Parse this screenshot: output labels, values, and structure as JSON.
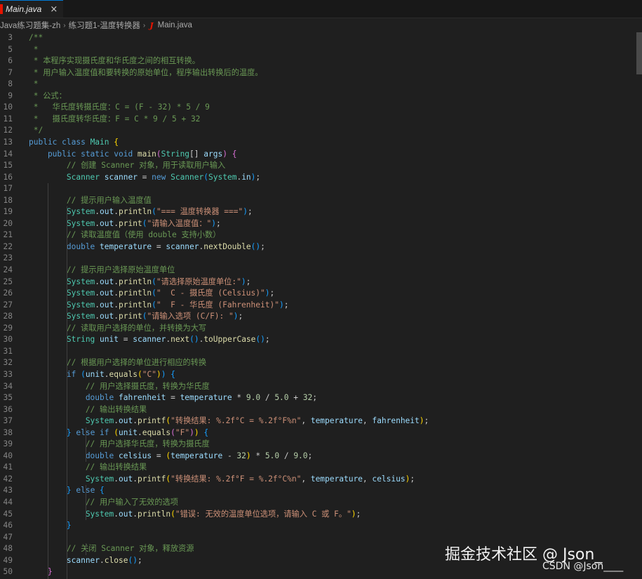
{
  "tab": {
    "label": "Main.java",
    "close": "×"
  },
  "breadcrumb": [
    "Java练习题集-zh",
    "练习题1-温度转换器",
    "Main.java"
  ],
  "breadcrumb_sep": "›",
  "java_icon": "J",
  "watermark": {
    "primary": "掘金技术社区 @ Json_",
    "secondary": "CSDN @Json____"
  },
  "lines": [
    {
      "n": "3",
      "t": [
        [
          "/**",
          "c-cm"
        ]
      ]
    },
    {
      "n": "5",
      "t": [
        [
          " *",
          "c-cm"
        ]
      ]
    },
    {
      "n": "6",
      "t": [
        [
          " * 本程序实现摄氏度和华氏度之间的相互转换。",
          "c-cm"
        ]
      ]
    },
    {
      "n": "7",
      "t": [
        [
          " * 用户输入温度值和要转换的原始单位，程序输出转换后的温度。",
          "c-cm"
        ]
      ]
    },
    {
      "n": "8",
      "t": [
        [
          " *",
          "c-cm"
        ]
      ]
    },
    {
      "n": "9",
      "t": [
        [
          " * 公式：",
          "c-cm"
        ]
      ]
    },
    {
      "n": "10",
      "t": [
        [
          " *   华氏度转摄氏度：C = (F - 32) * 5 / 9",
          "c-cm"
        ]
      ]
    },
    {
      "n": "11",
      "t": [
        [
          " *   摄氏度转华氏度：F = C * 9 / 5 + 32",
          "c-cm"
        ]
      ]
    },
    {
      "n": "12",
      "t": [
        [
          " */",
          "c-cm"
        ]
      ]
    },
    {
      "n": "13",
      "t": [
        [
          "public class ",
          "c-kw"
        ],
        [
          "Main ",
          "c-ty"
        ],
        [
          "{",
          "c-br1"
        ]
      ]
    },
    {
      "n": "14",
      "t": [
        [
          "    public static void ",
          "c-kw"
        ],
        [
          "main",
          "c-fn"
        ],
        [
          "(",
          "c-br2"
        ],
        [
          "String",
          "c-ty"
        ],
        [
          "[] ",
          "c-pl"
        ],
        [
          "args",
          "c-vr"
        ],
        [
          ") ",
          "c-br2"
        ],
        [
          "{",
          "c-br2"
        ]
      ]
    },
    {
      "n": "15",
      "t": [
        [
          "        // 创建 Scanner 对象，用于读取用户输入",
          "c-cm"
        ]
      ]
    },
    {
      "n": "16",
      "t": [
        [
          "        Scanner ",
          "c-ty"
        ],
        [
          "scanner",
          "c-vr"
        ],
        [
          " = ",
          "c-pl"
        ],
        [
          "new ",
          "c-kw"
        ],
        [
          "Scanner",
          "c-ty"
        ],
        [
          "(",
          "c-br3"
        ],
        [
          "System",
          "c-ty"
        ],
        [
          ".",
          "c-pl"
        ],
        [
          "in",
          "c-vr"
        ],
        [
          ")",
          "c-br3"
        ],
        [
          ";",
          "c-pl"
        ]
      ]
    },
    {
      "n": "17",
      "t": [
        [
          "",
          "c-pl"
        ]
      ]
    },
    {
      "n": "18",
      "t": [
        [
          "        // 提示用户输入温度值",
          "c-cm"
        ]
      ]
    },
    {
      "n": "19",
      "t": [
        [
          "        System",
          "c-ty"
        ],
        [
          ".",
          "c-pl"
        ],
        [
          "out",
          "c-vr"
        ],
        [
          ".",
          "c-pl"
        ],
        [
          "println",
          "c-fn"
        ],
        [
          "(",
          "c-br3"
        ],
        [
          "\"=== 温度转换器 ===\"",
          "c-st"
        ],
        [
          ")",
          "c-br3"
        ],
        [
          ";",
          "c-pl"
        ]
      ]
    },
    {
      "n": "20",
      "t": [
        [
          "        System",
          "c-ty"
        ],
        [
          ".",
          "c-pl"
        ],
        [
          "out",
          "c-vr"
        ],
        [
          ".",
          "c-pl"
        ],
        [
          "print",
          "c-fn"
        ],
        [
          "(",
          "c-br3"
        ],
        [
          "\"请输入温度值：\"",
          "c-st"
        ],
        [
          ")",
          "c-br3"
        ],
        [
          ";",
          "c-pl"
        ]
      ]
    },
    {
      "n": "21",
      "t": [
        [
          "        // 读取温度值（使用 double 支持小数）",
          "c-cm"
        ]
      ]
    },
    {
      "n": "22",
      "t": [
        [
          "        double ",
          "c-kw"
        ],
        [
          "temperature",
          "c-vr"
        ],
        [
          " = ",
          "c-pl"
        ],
        [
          "scanner",
          "c-vr"
        ],
        [
          ".",
          "c-pl"
        ],
        [
          "nextDouble",
          "c-fn"
        ],
        [
          "()",
          "c-br3"
        ],
        [
          ";",
          "c-pl"
        ]
      ]
    },
    {
      "n": "23",
      "t": [
        [
          "",
          "c-pl"
        ]
      ]
    },
    {
      "n": "24",
      "t": [
        [
          "        // 提示用户选择原始温度单位",
          "c-cm"
        ]
      ]
    },
    {
      "n": "25",
      "t": [
        [
          "        System",
          "c-ty"
        ],
        [
          ".",
          "c-pl"
        ],
        [
          "out",
          "c-vr"
        ],
        [
          ".",
          "c-pl"
        ],
        [
          "println",
          "c-fn"
        ],
        [
          "(",
          "c-br3"
        ],
        [
          "\"请选择原始温度单位:\"",
          "c-st"
        ],
        [
          ")",
          "c-br3"
        ],
        [
          ";",
          "c-pl"
        ]
      ]
    },
    {
      "n": "26",
      "t": [
        [
          "        System",
          "c-ty"
        ],
        [
          ".",
          "c-pl"
        ],
        [
          "out",
          "c-vr"
        ],
        [
          ".",
          "c-pl"
        ],
        [
          "println",
          "c-fn"
        ],
        [
          "(",
          "c-br3"
        ],
        [
          "\"  C - 摄氏度 (Celsius)\"",
          "c-st"
        ],
        [
          ")",
          "c-br3"
        ],
        [
          ";",
          "c-pl"
        ]
      ]
    },
    {
      "n": "27",
      "t": [
        [
          "        System",
          "c-ty"
        ],
        [
          ".",
          "c-pl"
        ],
        [
          "out",
          "c-vr"
        ],
        [
          ".",
          "c-pl"
        ],
        [
          "println",
          "c-fn"
        ],
        [
          "(",
          "c-br3"
        ],
        [
          "\"  F - 华氏度 (Fahrenheit)\"",
          "c-st"
        ],
        [
          ")",
          "c-br3"
        ],
        [
          ";",
          "c-pl"
        ]
      ]
    },
    {
      "n": "28",
      "t": [
        [
          "        System",
          "c-ty"
        ],
        [
          ".",
          "c-pl"
        ],
        [
          "out",
          "c-vr"
        ],
        [
          ".",
          "c-pl"
        ],
        [
          "print",
          "c-fn"
        ],
        [
          "(",
          "c-br3"
        ],
        [
          "\"请输入选项 (C/F): \"",
          "c-st"
        ],
        [
          ")",
          "c-br3"
        ],
        [
          ";",
          "c-pl"
        ]
      ]
    },
    {
      "n": "29",
      "t": [
        [
          "        // 读取用户选择的单位，并转换为大写",
          "c-cm"
        ]
      ]
    },
    {
      "n": "30",
      "t": [
        [
          "        String ",
          "c-ty"
        ],
        [
          "unit",
          "c-vr"
        ],
        [
          " = ",
          "c-pl"
        ],
        [
          "scanner",
          "c-vr"
        ],
        [
          ".",
          "c-pl"
        ],
        [
          "next",
          "c-fn"
        ],
        [
          "()",
          "c-br3"
        ],
        [
          ".",
          "c-pl"
        ],
        [
          "toUpperCase",
          "c-fn"
        ],
        [
          "()",
          "c-br3"
        ],
        [
          ";",
          "c-pl"
        ]
      ]
    },
    {
      "n": "31",
      "t": [
        [
          "",
          "c-pl"
        ]
      ]
    },
    {
      "n": "32",
      "t": [
        [
          "        // 根据用户选择的单位进行相应的转换",
          "c-cm"
        ]
      ]
    },
    {
      "n": "33",
      "t": [
        [
          "        if ",
          "c-kw"
        ],
        [
          "(",
          "c-br3"
        ],
        [
          "unit",
          "c-vr"
        ],
        [
          ".",
          "c-pl"
        ],
        [
          "equals",
          "c-fn"
        ],
        [
          "(",
          "c-br1"
        ],
        [
          "\"C\"",
          "c-st"
        ],
        [
          ")",
          "c-br1"
        ],
        [
          ") ",
          "c-br3"
        ],
        [
          "{",
          "c-br3"
        ]
      ]
    },
    {
      "n": "34",
      "t": [
        [
          "            // 用户选择摄氏度，转换为华氏度",
          "c-cm"
        ]
      ]
    },
    {
      "n": "35",
      "t": [
        [
          "            double ",
          "c-kw"
        ],
        [
          "fahrenheit",
          "c-vr"
        ],
        [
          " = ",
          "c-pl"
        ],
        [
          "temperature",
          "c-vr"
        ],
        [
          " * ",
          "c-pl"
        ],
        [
          "9.0",
          "c-nm"
        ],
        [
          " / ",
          "c-pl"
        ],
        [
          "5.0",
          "c-nm"
        ],
        [
          " + ",
          "c-pl"
        ],
        [
          "32",
          "c-nm"
        ],
        [
          ";",
          "c-pl"
        ]
      ]
    },
    {
      "n": "36",
      "t": [
        [
          "            // 输出转换结果",
          "c-cm"
        ]
      ]
    },
    {
      "n": "37",
      "t": [
        [
          "            System",
          "c-ty"
        ],
        [
          ".",
          "c-pl"
        ],
        [
          "out",
          "c-vr"
        ],
        [
          ".",
          "c-pl"
        ],
        [
          "printf",
          "c-fn"
        ],
        [
          "(",
          "c-br1"
        ],
        [
          "\"转换结果: %.2f°C = %.2f°F%n\"",
          "c-st"
        ],
        [
          ", ",
          "c-pl"
        ],
        [
          "temperature",
          "c-vr"
        ],
        [
          ", ",
          "c-pl"
        ],
        [
          "fahrenheit",
          "c-vr"
        ],
        [
          ")",
          "c-br1"
        ],
        [
          ";",
          "c-pl"
        ]
      ]
    },
    {
      "n": "38",
      "t": [
        [
          "        } ",
          "c-br3"
        ],
        [
          "else if ",
          "c-kw"
        ],
        [
          "(",
          "c-br1"
        ],
        [
          "unit",
          "c-vr"
        ],
        [
          ".",
          "c-pl"
        ],
        [
          "equals",
          "c-fn"
        ],
        [
          "(",
          "c-br2"
        ],
        [
          "\"F\"",
          "c-st"
        ],
        [
          ")",
          "c-br2"
        ],
        [
          ") ",
          "c-br1"
        ],
        [
          "{",
          "c-br3"
        ]
      ]
    },
    {
      "n": "39",
      "t": [
        [
          "            // 用户选择华氏度，转换为摄氏度",
          "c-cm"
        ]
      ]
    },
    {
      "n": "40",
      "t": [
        [
          "            double ",
          "c-kw"
        ],
        [
          "celsius",
          "c-vr"
        ],
        [
          " = ",
          "c-pl"
        ],
        [
          "(",
          "c-br1"
        ],
        [
          "temperature",
          "c-vr"
        ],
        [
          " - ",
          "c-pl"
        ],
        [
          "32",
          "c-nm"
        ],
        [
          ") ",
          "c-br1"
        ],
        [
          "* ",
          "c-pl"
        ],
        [
          "5.0",
          "c-nm"
        ],
        [
          " / ",
          "c-pl"
        ],
        [
          "9.0",
          "c-nm"
        ],
        [
          ";",
          "c-pl"
        ]
      ]
    },
    {
      "n": "41",
      "t": [
        [
          "            // 输出转换结果",
          "c-cm"
        ]
      ]
    },
    {
      "n": "42",
      "t": [
        [
          "            System",
          "c-ty"
        ],
        [
          ".",
          "c-pl"
        ],
        [
          "out",
          "c-vr"
        ],
        [
          ".",
          "c-pl"
        ],
        [
          "printf",
          "c-fn"
        ],
        [
          "(",
          "c-br1"
        ],
        [
          "\"转换结果: %.2f°F = %.2f°C%n\"",
          "c-st"
        ],
        [
          ", ",
          "c-pl"
        ],
        [
          "temperature",
          "c-vr"
        ],
        [
          ", ",
          "c-pl"
        ],
        [
          "celsius",
          "c-vr"
        ],
        [
          ")",
          "c-br1"
        ],
        [
          ";",
          "c-pl"
        ]
      ]
    },
    {
      "n": "43",
      "t": [
        [
          "        } ",
          "c-br3"
        ],
        [
          "else ",
          "c-kw"
        ],
        [
          "{",
          "c-br3"
        ]
      ]
    },
    {
      "n": "44",
      "t": [
        [
          "            // 用户输入了无效的选项",
          "c-cm"
        ]
      ]
    },
    {
      "n": "45",
      "t": [
        [
          "            System",
          "c-ty"
        ],
        [
          ".",
          "c-pl"
        ],
        [
          "out",
          "c-vr"
        ],
        [
          ".",
          "c-pl"
        ],
        [
          "println",
          "c-fn"
        ],
        [
          "(",
          "c-br1"
        ],
        [
          "\"错误: 无效的温度单位选项，请输入 C 或 F。\"",
          "c-st"
        ],
        [
          ")",
          "c-br1"
        ],
        [
          ";",
          "c-pl"
        ]
      ]
    },
    {
      "n": "46",
      "t": [
        [
          "        }",
          "c-br3"
        ]
      ]
    },
    {
      "n": "47",
      "t": [
        [
          "",
          "c-pl"
        ]
      ]
    },
    {
      "n": "48",
      "t": [
        [
          "        // 关闭 Scanner 对象，释放资源",
          "c-cm"
        ]
      ]
    },
    {
      "n": "49",
      "t": [
        [
          "        scanner",
          "c-vr"
        ],
        [
          ".",
          "c-pl"
        ],
        [
          "close",
          "c-fn"
        ],
        [
          "()",
          "c-br3"
        ],
        [
          ";",
          "c-pl"
        ]
      ]
    },
    {
      "n": "50",
      "t": [
        [
          "    }",
          "c-br2"
        ]
      ]
    }
  ]
}
